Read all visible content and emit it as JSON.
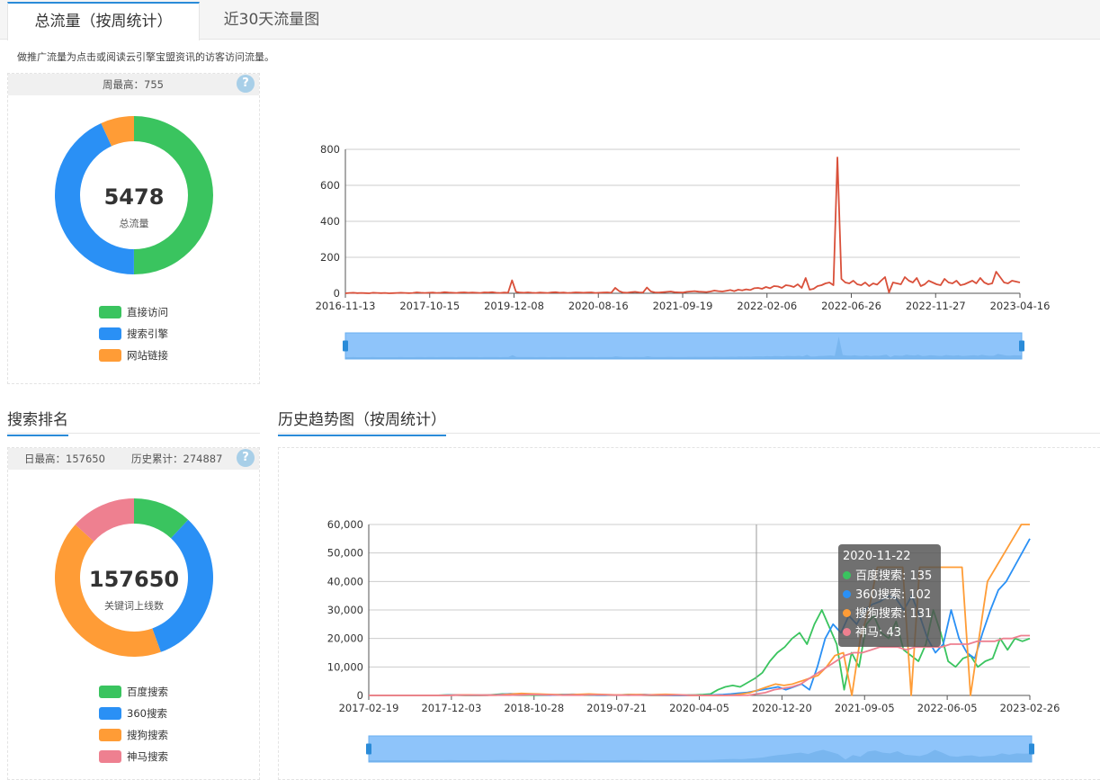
{
  "tabs": [
    {
      "label": "总流量（按周统计）",
      "active": true
    },
    {
      "label": "近30天流量图",
      "active": false
    }
  ],
  "note": "做推广流量为点击或阅读云引擎宝盟资讯的访客访问流量。",
  "traffic": {
    "stat_text": "周最高：755",
    "total_value": "5478",
    "total_label": "总流量",
    "help_icon": "?",
    "legend": [
      {
        "label": "直接访问",
        "color": "#3ac45f"
      },
      {
        "label": "搜索引擎",
        "color": "#2a90f5"
      },
      {
        "label": "网站链接",
        "color": "#ff9c36"
      }
    ]
  },
  "search": {
    "title": "搜索排名",
    "stat_daily": "日最高：157650",
    "stat_total": "历史累计：274887",
    "help_icon": "?",
    "center_value": "157650",
    "center_label": "关键词上线数",
    "legend": [
      {
        "label": "百度搜索",
        "color": "#3ac45f"
      },
      {
        "label": "360搜索",
        "color": "#2a90f5"
      },
      {
        "label": "搜狗搜索",
        "color": "#ff9c36"
      },
      {
        "label": "神马搜索",
        "color": "#ee8090"
      }
    ]
  },
  "trend": {
    "title": "历史趋势图（按周统计）"
  },
  "tooltip": {
    "date": "2020-11-22",
    "rows": [
      {
        "label": "百度搜索: 135",
        "color": "#3ac45f"
      },
      {
        "label": "360搜索: 102",
        "color": "#2a90f5"
      },
      {
        "label": "搜狗搜索: 131",
        "color": "#ff9c36"
      },
      {
        "label": "神马: 43",
        "color": "#ee8090"
      }
    ]
  },
  "chart_data": [
    {
      "type": "pie",
      "title": "",
      "labels": [
        "直接访问",
        "搜索引擎",
        "网站链接"
      ],
      "values": [
        2740,
        2364,
        374
      ],
      "colors": [
        "#3ac45f",
        "#2a90f5",
        "#ff9c36"
      ]
    },
    {
      "type": "line",
      "series": [
        {
          "name": "",
          "color": "#d9503a",
          "values": [
            0,
            2,
            3,
            1,
            2,
            1,
            0,
            3,
            2,
            1,
            2,
            0,
            1,
            2,
            3,
            2,
            1,
            2,
            5,
            3,
            2,
            3,
            4,
            2,
            3,
            6,
            4,
            3,
            2,
            4,
            5,
            3,
            4,
            3,
            2,
            5,
            4,
            6,
            3,
            2,
            4,
            3,
            72,
            8,
            4,
            3,
            5,
            3,
            2,
            4,
            3,
            2,
            5,
            6,
            3,
            4,
            2,
            3,
            5,
            4,
            3,
            4,
            5,
            2,
            3,
            4,
            5,
            3,
            30,
            12,
            4,
            3,
            6,
            8,
            5,
            4,
            32,
            10,
            5,
            4,
            6,
            8,
            10,
            6,
            5,
            4,
            8,
            10,
            12,
            9,
            8,
            7,
            10,
            15,
            12,
            10,
            14,
            18,
            12,
            20,
            16,
            22,
            18,
            28,
            30,
            25,
            35,
            28,
            40,
            38,
            30,
            45,
            42,
            35,
            50,
            30,
            85,
            20,
            25,
            40,
            45,
            55,
            60,
            45,
            755,
            80,
            60,
            55,
            70,
            50,
            45,
            60,
            40,
            55,
            48,
            70,
            90,
            5,
            60,
            55,
            50,
            90,
            70,
            60,
            85,
            40,
            50,
            70,
            60,
            50,
            45,
            80,
            60,
            55,
            70,
            45,
            50,
            60,
            70,
            55,
            85,
            60,
            50,
            55,
            120,
            90,
            60,
            55,
            70,
            65,
            60
          ]
        }
      ],
      "x_ticks": [
        "2016-11-13",
        "2017-10-15",
        "2019-12-08",
        "2020-08-16",
        "2021-09-19",
        "2022-02-06",
        "2022-06-26",
        "2022-11-27",
        "2023-04-16"
      ],
      "y_ticks": [
        0,
        200,
        400,
        600,
        800
      ],
      "ylim": [
        0,
        800
      ],
      "grid": true
    },
    {
      "type": "pie",
      "title": "",
      "labels": [
        "百度搜索",
        "360搜索",
        "搜狗搜索",
        "神马搜索"
      ],
      "values": [
        18900,
        51250,
        66500,
        21000
      ],
      "colors": [
        "#3ac45f",
        "#2a90f5",
        "#ff9c36",
        "#ee8090"
      ]
    },
    {
      "type": "line",
      "x_ticks": [
        "2017-02-19",
        "2017-12-03",
        "2018-10-28",
        "2019-07-21",
        "2020-04-05",
        "2020-12-20",
        "2021-09-05",
        "2022-06-05",
        "2023-02-26"
      ],
      "y_ticks": [
        0,
        10000,
        20000,
        30000,
        40000,
        50000,
        60000
      ],
      "y_tick_labels": [
        "0",
        "10,000",
        "20,000",
        "30,000",
        "40,000",
        "50,000",
        "60,000"
      ],
      "ylim": [
        0,
        60000
      ],
      "grid": true,
      "series": [
        {
          "name": "百度搜索",
          "color": "#3ac45f",
          "values": [
            0,
            0,
            0,
            0,
            0,
            0,
            0,
            0,
            0,
            0,
            100,
            200,
            100,
            0,
            0,
            0,
            100,
            300,
            500,
            400,
            300,
            200,
            100,
            100,
            100,
            200,
            300,
            200,
            200,
            100,
            100,
            100,
            100,
            100,
            200,
            300,
            200,
            100,
            0,
            0,
            0,
            0,
            0,
            135,
            200,
            300,
            500,
            2000,
            3000,
            3500,
            3000,
            4500,
            6000,
            8000,
            12000,
            15000,
            17000,
            20000,
            22000,
            18000,
            25000,
            30000,
            24000,
            18000,
            2000,
            15000,
            10000,
            25000,
            28000,
            22000,
            20000,
            26000,
            16000,
            14000,
            12000,
            18000,
            30000,
            22000,
            12000,
            10000,
            13000,
            14000,
            10000,
            12000,
            13000,
            20000,
            16000,
            20000,
            19000,
            20000
          ]
        },
        {
          "name": "360搜索",
          "color": "#2a90f5",
          "values": [
            0,
            0,
            0,
            0,
            0,
            0,
            0,
            0,
            0,
            0,
            100,
            200,
            200,
            100,
            100,
            100,
            200,
            400,
            600,
            500,
            400,
            300,
            200,
            100,
            200,
            300,
            400,
            300,
            200,
            100,
            100,
            200,
            200,
            100,
            200,
            300,
            200,
            100,
            0,
            0,
            0,
            0,
            0,
            102,
            200,
            300,
            500,
            800,
            1000,
            1500,
            2000,
            2500,
            3000,
            2000,
            3000,
            4000,
            2000,
            10000,
            20000,
            25000,
            22000,
            28000,
            25000,
            30000,
            32000,
            33000,
            35000,
            34000,
            30000,
            35000,
            28000,
            20000,
            15000,
            18000,
            30000,
            20000,
            15000,
            13000,
            22000,
            30000,
            37000,
            40000,
            45000,
            50000,
            55000
          ]
        },
        {
          "name": "搜狗搜索",
          "color": "#ff9c36",
          "values": [
            0,
            0,
            0,
            0,
            0,
            0,
            0,
            0,
            0,
            0,
            100,
            200,
            200,
            100,
            100,
            100,
            300,
            500,
            700,
            600,
            500,
            400,
            300,
            200,
            300,
            400,
            500,
            400,
            300,
            200,
            200,
            300,
            300,
            200,
            300,
            400,
            300,
            200,
            0,
            0,
            0,
            0,
            0,
            131,
            500,
            1000,
            2000,
            3000,
            4000,
            3500,
            4000,
            5000,
            6000,
            7000,
            10000,
            14000,
            15000,
            0,
            20000,
            30000,
            45000,
            45000,
            45000,
            45000,
            0,
            45000,
            45000,
            45000,
            45000,
            45000,
            45000,
            0,
            20000,
            40000,
            45000,
            50000,
            55000,
            60000,
            60000
          ]
        },
        {
          "name": "神马",
          "color": "#ee8090",
          "values": [
            0,
            0,
            0,
            0,
            0,
            0,
            0,
            0,
            0,
            0,
            100,
            100,
            100,
            100,
            100,
            100,
            100,
            200,
            300,
            300,
            200,
            200,
            100,
            100,
            100,
            200,
            200,
            200,
            100,
            100,
            100,
            100,
            100,
            100,
            100,
            200,
            100,
            100,
            0,
            0,
            0,
            0,
            0,
            43,
            500,
            1000,
            2000,
            2500,
            3000,
            4000,
            6000,
            8000,
            10000,
            12000,
            14000,
            15000,
            15000,
            16000,
            17000,
            17000,
            17000,
            16000,
            17000,
            17000,
            17000,
            17000,
            18000,
            18000,
            18000,
            19000,
            19000,
            19000,
            20000,
            20000,
            21000,
            21000
          ]
        }
      ]
    }
  ]
}
